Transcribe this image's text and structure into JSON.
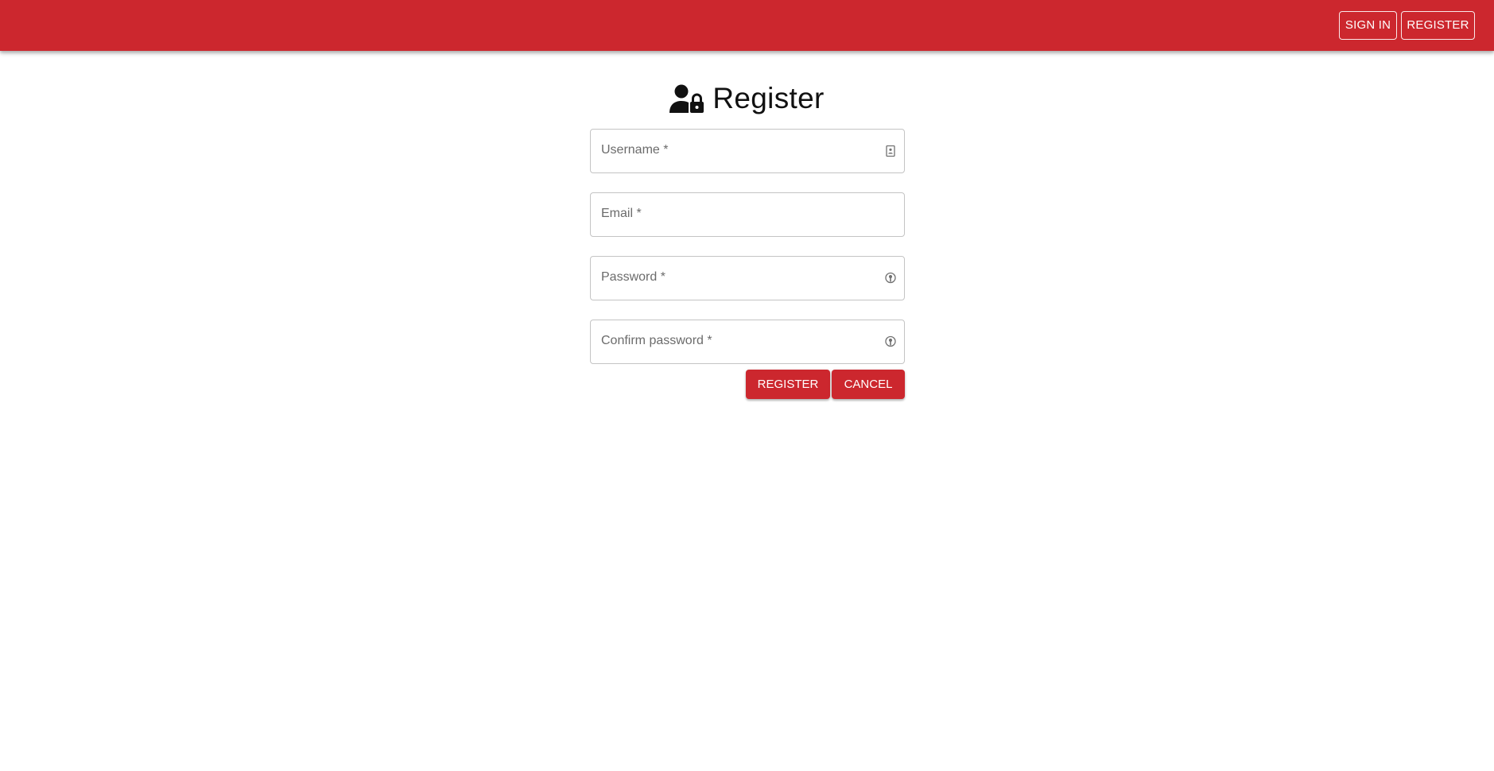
{
  "header": {
    "brand_color": "#cc272e",
    "nav": {
      "sign_in_label": "SIGN IN",
      "register_label": "REGISTER"
    }
  },
  "form": {
    "title": "Register",
    "title_icon": "user-lock-icon",
    "fields": {
      "username": {
        "label": "Username *",
        "value": "",
        "icon": "contact-card-icon"
      },
      "email": {
        "label": "Email *",
        "value": ""
      },
      "password": {
        "label": "Password *",
        "value": "",
        "icon": "key-icon"
      },
      "confirm_password": {
        "label": "Confirm password *",
        "value": "",
        "icon": "key-icon"
      }
    },
    "actions": {
      "register_label": "REGISTER",
      "cancel_label": "CANCEL"
    }
  }
}
